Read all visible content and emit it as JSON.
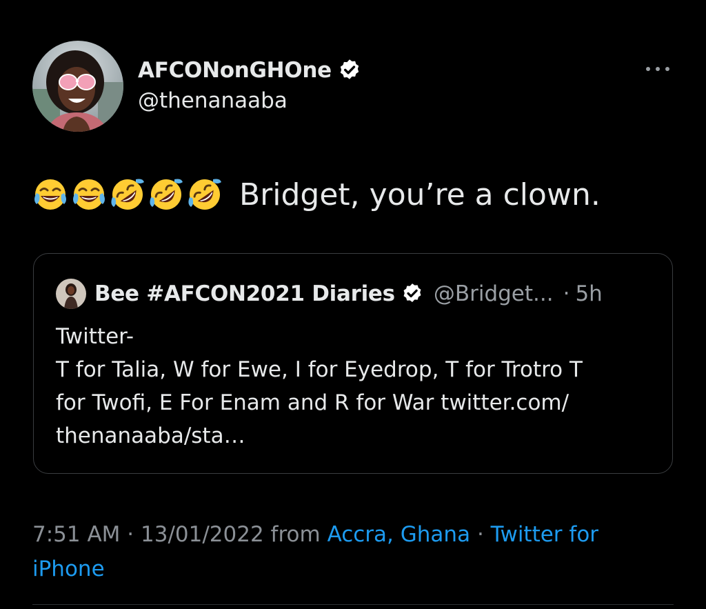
{
  "author": {
    "display_name": "AFCONonGHOne",
    "handle": "@thenanaaba",
    "avatar_icon": "profile-photo",
    "verified": true
  },
  "more_icon": "more-horizontal-icon",
  "tweet": {
    "emojis": [
      "face-with-tears-of-joy",
      "face-with-tears-of-joy",
      "rolling-on-the-floor-laughing",
      "rolling-on-the-floor-laughing",
      "rolling-on-the-floor-laughing"
    ],
    "text": "Bridget, you’re a clown."
  },
  "quoted_tweet": {
    "display_name": "Bee #AFCON2021 Diaries",
    "handle": "@Bridget...",
    "separator": "·",
    "time_ago": "5h",
    "verified": true,
    "text_lines": [
      "Twitter-",
      "T for Talia, W for Ewe, I for Eyedrop, T for Trotro T",
      "for Twofi, E For Enam and R for War twitter.com/",
      "thenanaaba/sta…"
    ]
  },
  "meta": {
    "time": "7:51 AM",
    "sep1": "·",
    "date": "13/01/2022",
    "from_word": "from",
    "location": "Accra, Ghana",
    "sep2": "·",
    "source_part1": "Twitter for",
    "source_part2": "iPhone"
  },
  "colors": {
    "background": "#000000",
    "text": "#e7e9ea",
    "secondary": "#8b9096",
    "link": "#1d9bf0",
    "border": "#3a3d40"
  }
}
